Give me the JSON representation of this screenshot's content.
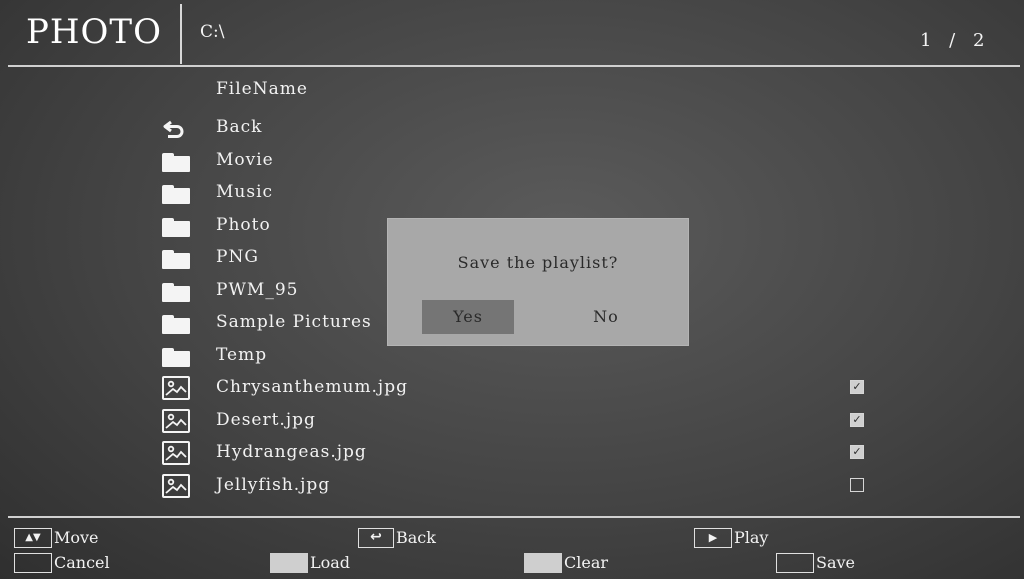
{
  "header": {
    "app_title": "PHOTO",
    "path": "C:\\",
    "page_indicator": "1 / 2"
  },
  "file_list": {
    "column_header": "FileName",
    "items": [
      {
        "name": "Back",
        "icon": "back-arrow-icon",
        "type": "back"
      },
      {
        "name": "Movie",
        "icon": "folder-icon",
        "type": "folder"
      },
      {
        "name": "Music",
        "icon": "folder-icon",
        "type": "folder"
      },
      {
        "name": "Photo",
        "icon": "folder-icon",
        "type": "folder"
      },
      {
        "name": "PNG",
        "icon": "folder-icon",
        "type": "folder"
      },
      {
        "name": "PWM_95",
        "icon": "folder-icon",
        "type": "folder"
      },
      {
        "name": "Sample Pictures",
        "icon": "folder-icon",
        "type": "folder"
      },
      {
        "name": "Temp",
        "icon": "folder-icon",
        "type": "folder"
      },
      {
        "name": "Chrysanthemum.jpg",
        "icon": "image-icon",
        "type": "image",
        "checked": true
      },
      {
        "name": "Desert.jpg",
        "icon": "image-icon",
        "type": "image",
        "checked": true
      },
      {
        "name": "Hydrangeas.jpg",
        "icon": "image-icon",
        "type": "image",
        "checked": true
      },
      {
        "name": "Jellyfish.jpg",
        "icon": "image-icon",
        "type": "image",
        "checked": false
      }
    ]
  },
  "dialog": {
    "message": "Save the playlist?",
    "yes_label": "Yes",
    "no_label": "No",
    "selected": "Yes"
  },
  "footer": {
    "move_label": "Move",
    "back_label": "Back",
    "play_label": "Play",
    "cancel_label": "Cancel",
    "load_label": "Load",
    "clear_label": "Clear",
    "save_label": "Save"
  },
  "colors": {
    "background": "#4a4a4a",
    "dialog_bg": "#a8a8a8",
    "selected_button": "#757575",
    "text": "#f2f2f2"
  }
}
